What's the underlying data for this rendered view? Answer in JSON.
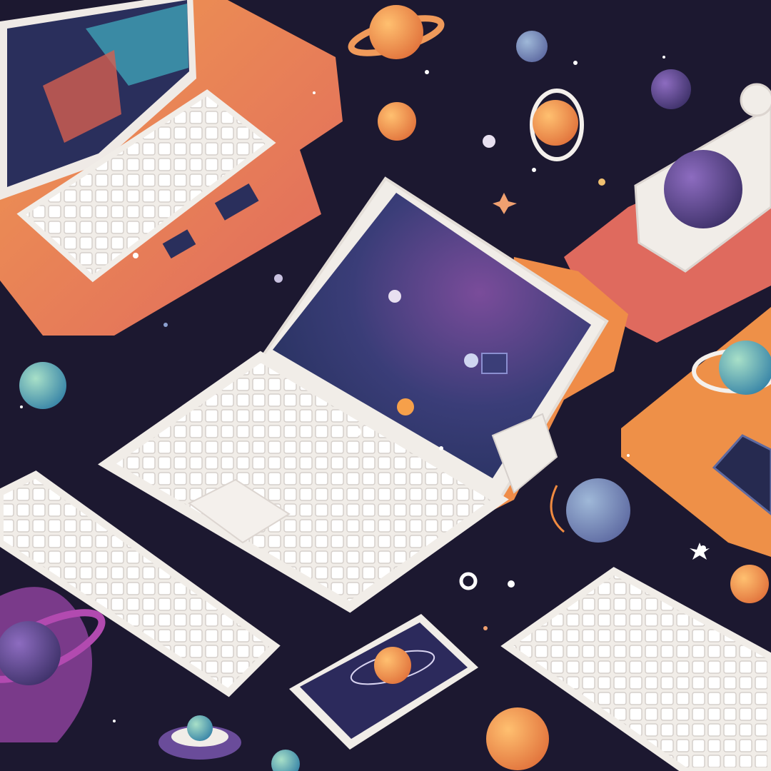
{
  "scene": {
    "palette": {
      "space_background": "#1c1830",
      "desk_orange": "#ec8a4c",
      "desk_coral": "#e0685e",
      "device_white": "#f1ede8",
      "key_shadow": "#d6d0cc",
      "screen_navy": "#25305c",
      "nebula_purple": "#7a4c9a",
      "planet_teal": "#5fb5c4",
      "planet_orange": "#f09040",
      "planet_violet": "#5d4a8c"
    },
    "objects": [
      "laptop-open-center",
      "laptop-top-left",
      "keyboard-bottom-left",
      "keyboard-bottom-right",
      "tablet-bottom-center",
      "globe-device-top-right",
      "ringed-planet-orange-top",
      "ringed-planet-orange-right",
      "planet-purple-large",
      "planet-teal-left",
      "planet-blue-grey-right",
      "planet-orange-bottom",
      "saturn-planet-bottom-left",
      "ufo-bottom",
      "stars-and-particles"
    ]
  }
}
